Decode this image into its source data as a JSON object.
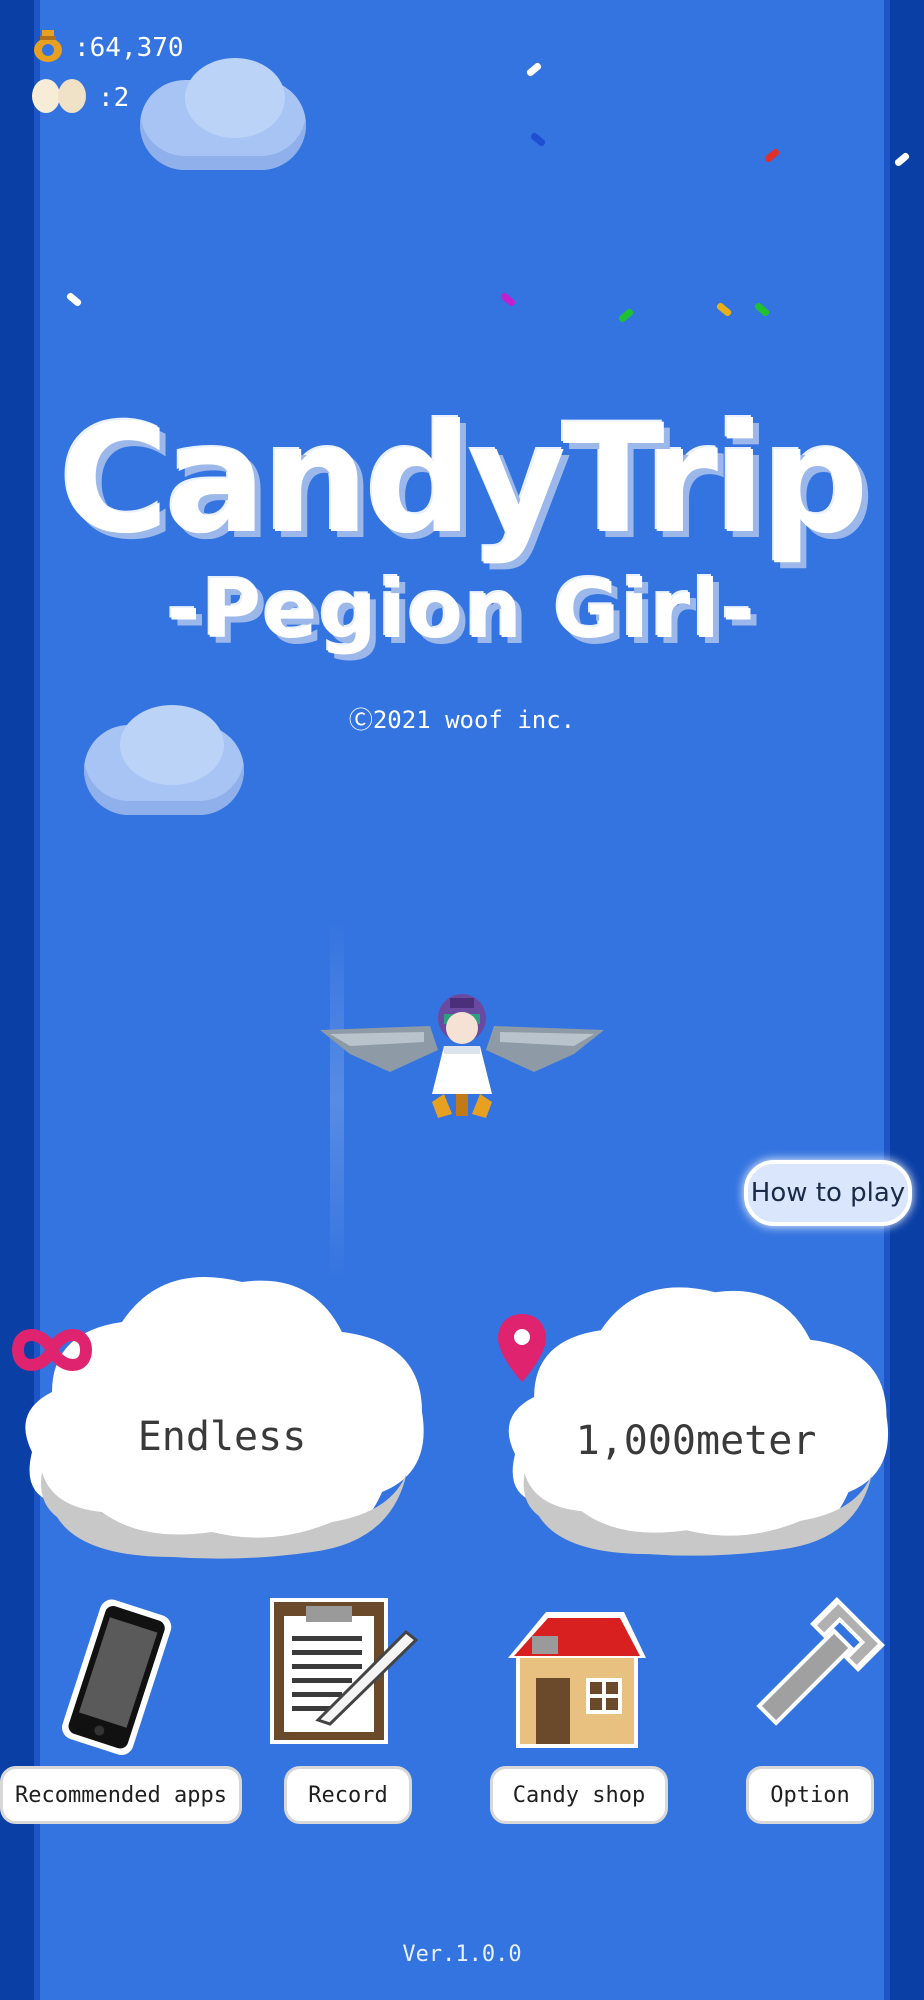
{
  "stats": {
    "coins": ":64,370",
    "eggs": ":2"
  },
  "title": {
    "main": "CandyTrip",
    "sub": "-Pegion Girl-"
  },
  "copyright": "Ⓒ2021 woof inc.",
  "how_to_play": "How to play",
  "modes": [
    {
      "label": "Endless",
      "icon": "infinity-icon",
      "icon_color": "#e0236f"
    },
    {
      "label": "1,000meter",
      "icon": "map-pin-icon",
      "icon_color": "#e0236f"
    }
  ],
  "menu": [
    {
      "label": "Recommended apps",
      "icon": "smartphone-icon"
    },
    {
      "label": "Record",
      "icon": "clipboard-icon"
    },
    {
      "label": "Candy shop",
      "icon": "house-icon"
    },
    {
      "label": "Option",
      "icon": "wrench-icon"
    }
  ],
  "version": "Ver.1.0.0",
  "colors": {
    "background": "#3474e0",
    "edge": "#0a3fa6",
    "accent": "#e0236f"
  }
}
